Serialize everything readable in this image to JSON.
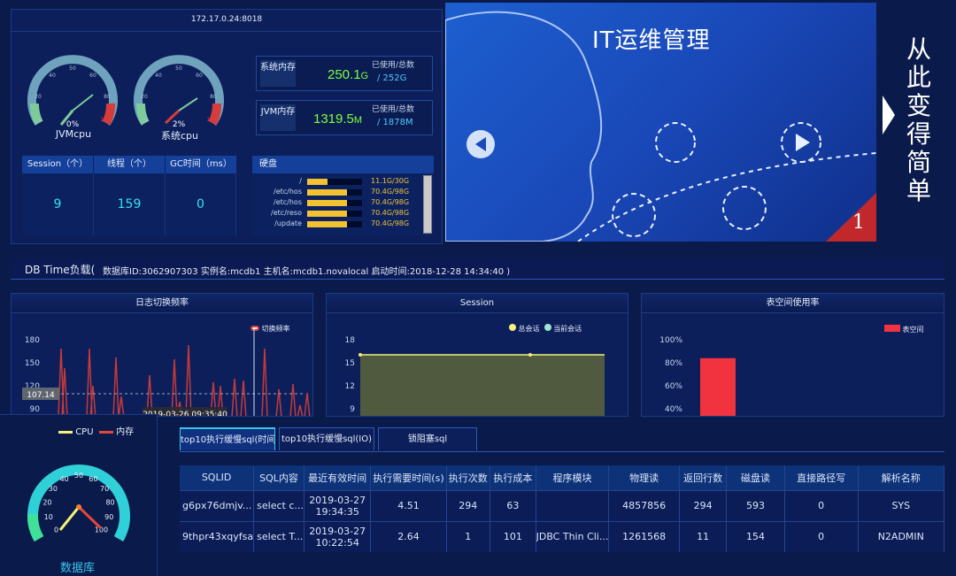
{
  "host": {
    "address": "172.17.0.24:8018"
  },
  "gauges": [
    {
      "label": "JVMcpu",
      "value_text": "0%",
      "value": 0,
      "ticks": [
        "0",
        "20",
        "40",
        "50",
        "60",
        "80",
        "100"
      ]
    },
    {
      "label": "系统cpu",
      "value_text": "2%",
      "value": 2,
      "ticks": [
        "0",
        "20",
        "40",
        "50",
        "60",
        "80",
        "100"
      ]
    }
  ],
  "memory": {
    "system": {
      "tag": "系统内存",
      "value": "250.1",
      "unit": "G",
      "sub": "已使用/总数",
      "total": "/ 252G"
    },
    "jvm": {
      "tag": "JVM内存",
      "value": "1319.5",
      "unit": "M",
      "sub": "已使用/总数",
      "total": "/ 1878M"
    }
  },
  "stats": {
    "headers": [
      "Session（个）",
      "线程（个）",
      "GC时间（ms）"
    ],
    "values": [
      "9",
      "159",
      "0"
    ]
  },
  "disk": {
    "title": "硬盘",
    "rows": [
      {
        "name": "/",
        "value": "11.1G/30G",
        "fraction": 0.37
      },
      {
        "name": "/etc/hos",
        "value": "70.4G/98G",
        "fraction": 0.72
      },
      {
        "name": "/etc/hos",
        "value": "70.4G/98G",
        "fraction": 0.72
      },
      {
        "name": "/etc/reso",
        "value": "70.4G/98G",
        "fraction": 0.72
      },
      {
        "name": "/update",
        "value": "70.4G/98G",
        "fraction": 0.72
      }
    ]
  },
  "banner": {
    "title": "IT运维管理",
    "page_number": "1",
    "side_text": "从此变得简单"
  },
  "dbtime": {
    "label": "DB Time负载(",
    "meta": "数据库ID:3062907303 实例名:mcdb1 主机名:mcdb1.novalocal 启动时间:2018-12-28 14:34:40 )"
  },
  "panels": {
    "log": {
      "title": "日志切换频率",
      "legend": "切换频率",
      "ticks": [
        "180",
        "150",
        "120",
        "90"
      ],
      "marker": "107.14",
      "tooltip": "2019-03-26 09:35:40"
    },
    "session": {
      "title": "Session",
      "legend": [
        "总会话",
        "当前会话"
      ],
      "ticks": [
        "18",
        "15",
        "12",
        "9"
      ]
    },
    "tablespace": {
      "title": "表空间使用率",
      "legend": "表空间",
      "ticks": [
        "100%",
        "80%",
        "60%",
        "40%"
      ]
    }
  },
  "chart_data": [
    {
      "type": "line",
      "title": "日志切换频率",
      "series": [
        {
          "name": "切换频率"
        }
      ],
      "ylim": [
        90,
        180
      ]
    },
    {
      "type": "area",
      "title": "Session",
      "series": [
        {
          "name": "总会话",
          "values": [
            16,
            16,
            16
          ]
        },
        {
          "name": "当前会话"
        }
      ],
      "ylim": [
        9,
        18
      ]
    },
    {
      "type": "bar",
      "title": "表空间使用率",
      "series": [
        {
          "name": "表空间",
          "values": [
            84
          ]
        }
      ],
      "ylim": [
        40,
        100
      ]
    },
    {
      "type": "gauge",
      "title": "数据库",
      "legend": [
        "CPU",
        "内存"
      ],
      "ticks": [
        "0",
        "10",
        "20",
        "30",
        "40",
        "50",
        "60",
        "70",
        "80",
        "90",
        "100"
      ]
    }
  ],
  "dbgauge": {
    "legend_cpu": "CPU",
    "legend_mem": "内存",
    "label": "数据库",
    "ticks": [
      "0",
      "10",
      "20",
      "30",
      "40",
      "50",
      "60",
      "70",
      "80",
      "90",
      "100"
    ]
  },
  "tabs": [
    "top10执行缓慢sql(时间)",
    "top10执行缓慢sql(IO)",
    "锁阻塞sql"
  ],
  "table": {
    "columns": [
      "SQLID",
      "SQL内容",
      "最近有效时间",
      "执行需要时间(s)",
      "执行次数",
      "执行成本",
      "程序模块",
      "物理读",
      "返回行数",
      "磁盘读",
      "直接路径写",
      "解析名称"
    ],
    "rows": [
      [
        "g6px76dmjv...",
        "select c...",
        "2019-03-27\n19:34:35",
        "4.51",
        "294",
        "63",
        "",
        "4857856",
        "294",
        "593",
        "0",
        "SYS"
      ],
      [
        "9thpr43xqyfsa",
        "select T...",
        "2019-03-27\n10:22:54",
        "2.64",
        "1",
        "101",
        "JDBC Thin Cli...",
        "1261568",
        "11",
        "154",
        "0",
        "N2ADMIN"
      ]
    ]
  },
  "colors": {
    "bg": "#0a1a4a",
    "panel": "#0d1f5a",
    "accent": "#38e0f0",
    "bar_red": "#f0333f",
    "disk_yellow": "#f2c233",
    "mem_green": "#7dff3e"
  }
}
